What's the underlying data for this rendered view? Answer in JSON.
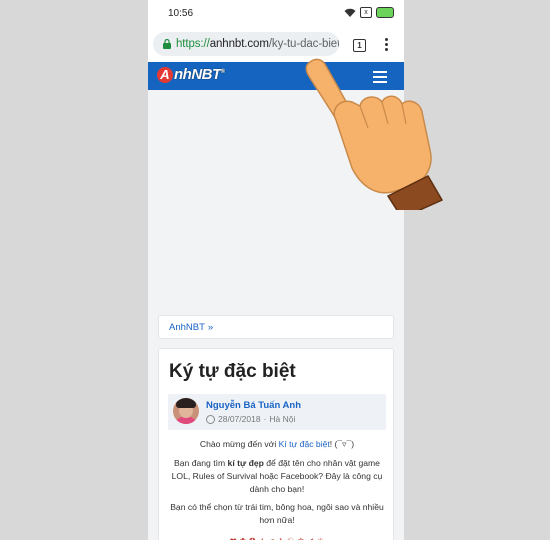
{
  "status_bar": {
    "time": "10:56",
    "notif_icon": "x"
  },
  "browser": {
    "url_scheme": "https://",
    "url_host": "anhnbt.com",
    "url_path": "/ky-tu-dac-biet",
    "tab_count": "1"
  },
  "site": {
    "logo_mark": "A",
    "logo_text": "nhNBT",
    "logo_sup": "®"
  },
  "breadcrumb": {
    "home": "AnhNBT",
    "sep": "»"
  },
  "article": {
    "title": "Ký tự đặc biệt",
    "author_name": "Nguyễn Bá Tuấn Anh",
    "date": "28/07/2018",
    "location": "Hà Nội",
    "p1_pre": "Chào mừng đến với ",
    "p1_link": "Kí tự đặc biệt",
    "p1_post": "! (¯▿¯)",
    "p2_pre": "Bạn đang tìm ",
    "p2_bold": "kí tự đẹp",
    "p2_post": " để đặt tên cho nhân vật game LOL, Rules of Survival hoặc Facebook? Đây là công cụ dành cho bạn!",
    "p3": "Bạn có thể chọn từ trái tim, bông hoa, ngôi sao và nhiều hơn nữa!",
    "p4": "❤ ✿ ✪ ★ ♫ ✈ ☯ ♚ ✔ ☀"
  },
  "colors": {
    "brand_blue": "#1565c0",
    "link": "#1a63c4",
    "secure_green": "#1e8e3e",
    "logo_red": "#e53935"
  }
}
